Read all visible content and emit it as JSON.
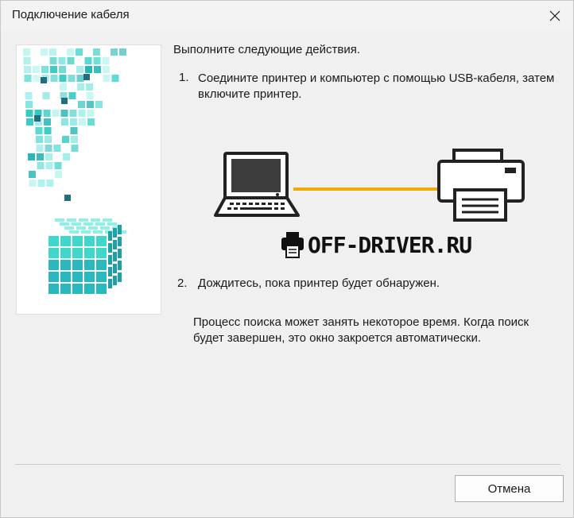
{
  "window": {
    "title": "Подключение кабеля",
    "close_icon": "close-icon"
  },
  "content": {
    "intro": "Выполните следующие действия.",
    "step1": {
      "number": "1.",
      "text": "Соедините принтер и компьютер с помощью USB-кабеля, затем включите принтер."
    },
    "step2": {
      "number": "2.",
      "text": "Дождитесь, пока принтер будет обнаружен."
    },
    "note": "Процесс поиска может занять некоторое время. Когда поиск будет завершен, это окно закроется автоматически."
  },
  "illustration": {
    "laptop_icon": "laptop-icon",
    "printer_icon": "printer-icon",
    "cable_color": "#f2a900"
  },
  "watermark": {
    "text": "OFF-DRIVER.RU",
    "icon": "printer-icon"
  },
  "footer": {
    "cancel_label": "Отмена"
  },
  "colors": {
    "accent": "#2fc9c0",
    "cube_dark": "#1f9fa8"
  }
}
